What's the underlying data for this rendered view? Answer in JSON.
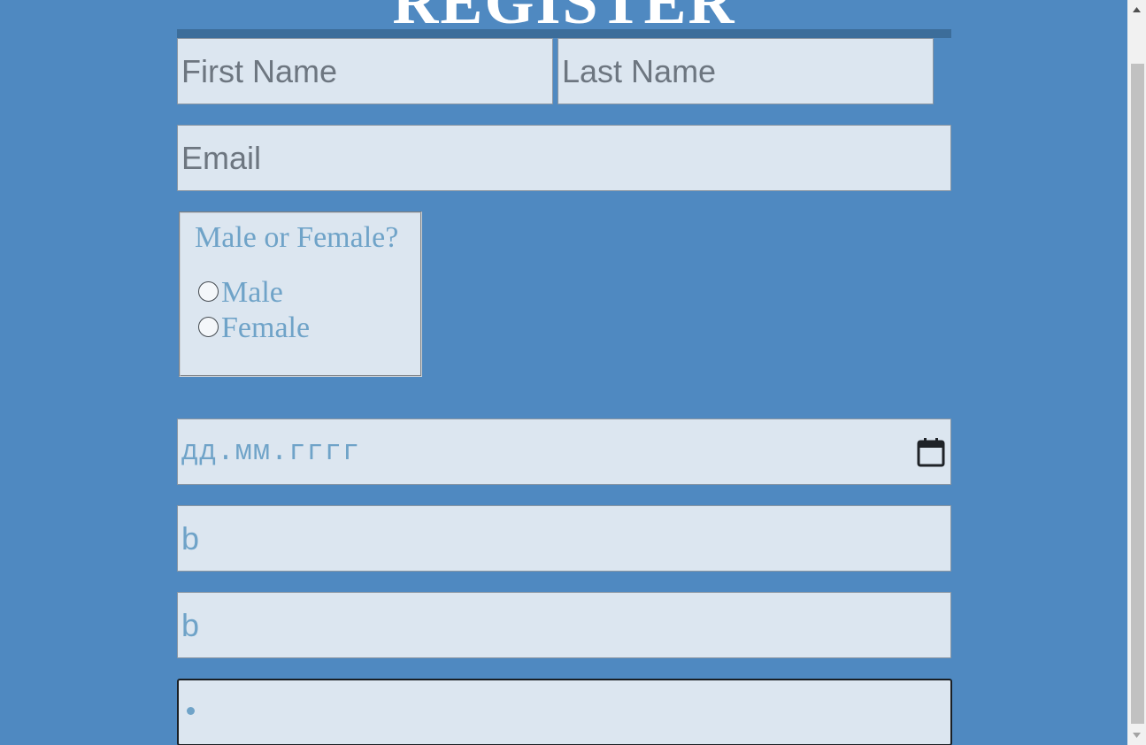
{
  "page": {
    "title": "REGISTER"
  },
  "form": {
    "first_name_placeholder": "First Name",
    "last_name_placeholder": "Last Name",
    "email_placeholder": "Email",
    "gender": {
      "legend": "Male or Female?",
      "options": [
        "Male",
        "Female"
      ]
    },
    "date_placeholder": "дд.мм.гггг",
    "field1_placeholder": "b",
    "field2_placeholder": "b"
  },
  "colors": {
    "background": "#4f89c1",
    "field_background": "#dce6f0",
    "title_rule": "#3c6d9a",
    "accent_text": "#6fa3c8",
    "placeholder_text": "#6d7680"
  },
  "icons": {
    "date_picker": "calendar-icon",
    "scroll_up": "scroll-up-arrow-icon",
    "scroll_down": "scroll-down-arrow-icon"
  }
}
